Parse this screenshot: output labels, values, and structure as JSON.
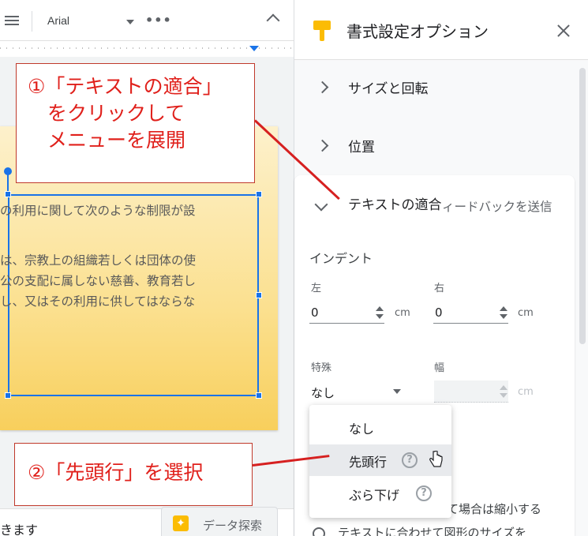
{
  "toolbar": {
    "font_name": "Arial",
    "more_label": "•••"
  },
  "slide": {
    "lines": [
      "の利用に関して次のような制限が設",
      "は、宗教上の組織若しくは団体の使",
      "公の支配に属しない慈善、教育若し",
      "し、又はその利用に供してはならな"
    ]
  },
  "bottom": {
    "text": "きます",
    "explore_label": "データ探索"
  },
  "panel": {
    "title": "書式設定オプション",
    "sections": [
      {
        "label": "サイズと回転",
        "expanded": false
      },
      {
        "label": "位置",
        "expanded": false
      },
      {
        "label": "テキストの適合",
        "expanded": true
      }
    ],
    "feedback": "ィードバックを送信",
    "indent": {
      "title": "インデント",
      "left_label": "左",
      "left_value": "0",
      "right_label": "右",
      "right_value": "0",
      "unit": "cm"
    },
    "special": {
      "label": "特殊",
      "value": "なし",
      "width_label": "幅",
      "width_unit": "cm"
    },
    "peek_text": "て場合は縮小する",
    "peek_text2": "テキストに合わせて図形のサイズを"
  },
  "dropdown": {
    "options": [
      {
        "label": "なし",
        "help": false
      },
      {
        "label": "先頭行",
        "help": true
      },
      {
        "label": "ぶら下げ",
        "help": true
      }
    ]
  },
  "annotations": {
    "callout1_lines": [
      "①「テキストの適合」",
      "　をクリックして",
      "　メニューを展開"
    ],
    "callout2": "②「先頭行」を選択",
    "color": "#e0201b"
  },
  "colors": {
    "accent": "#1a73e8",
    "highlight": "#fbbc04"
  }
}
